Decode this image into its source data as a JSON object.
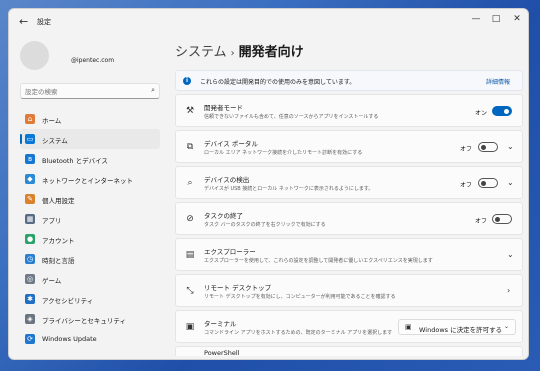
{
  "window": {
    "title": "設定",
    "back_icon": "←",
    "min": "—",
    "max": "□",
    "close": "✕"
  },
  "account": {
    "email": "@ipentec.com"
  },
  "search": {
    "placeholder": "設定の検索"
  },
  "nav": [
    {
      "label": "ホーム",
      "icon": "home-icon",
      "glyph": "⌂",
      "color": "#e07b39"
    },
    {
      "label": "システム",
      "icon": "system-icon",
      "glyph": "▭",
      "color": "#0a78d6",
      "active": true
    },
    {
      "label": "Bluetooth とデバイス",
      "icon": "bluetooth-icon",
      "glyph": "ʙ",
      "color": "#1677d2"
    },
    {
      "label": "ネットワークとインターネット",
      "icon": "network-icon",
      "glyph": "◆",
      "color": "#2a8ad6"
    },
    {
      "label": "個人用設定",
      "icon": "brush-icon",
      "glyph": "✎",
      "color": "#d9822b"
    },
    {
      "label": "アプリ",
      "icon": "apps-icon",
      "glyph": "▦",
      "color": "#5a6b85"
    },
    {
      "label": "アカウント",
      "icon": "account-icon",
      "glyph": "●",
      "color": "#2aa36a"
    },
    {
      "label": "時刻と言語",
      "icon": "time-language-icon",
      "glyph": "◷",
      "color": "#2b7fd0"
    },
    {
      "label": "ゲーム",
      "icon": "gaming-icon",
      "glyph": "◎",
      "color": "#6f7a86"
    },
    {
      "label": "アクセシビリティ",
      "icon": "accessibility-icon",
      "glyph": "✱",
      "color": "#1f6fc4"
    },
    {
      "label": "プライバシーとセキュリティ",
      "icon": "shield-icon",
      "glyph": "◈",
      "color": "#6b7480"
    },
    {
      "label": "Windows Update",
      "icon": "update-icon",
      "glyph": "⟳",
      "color": "#1f77d0"
    }
  ],
  "breadcrumb": {
    "parent": "システム",
    "separator": "›",
    "current": "開発者向け"
  },
  "info": {
    "text": "これらの設定は開発目的での使用のみを意図しています。",
    "link": "詳細情報"
  },
  "rows": [
    {
      "title": "開発者モード",
      "desc": "信頼できないファイルも含めて、任意のソースからアプリをインストールする",
      "icon": "developer-tools-icon",
      "glyph": "⚒",
      "state": "オン",
      "toggle": "on",
      "chevron": false
    },
    {
      "title": "デバイス ポータル",
      "desc": "ローカル エリア ネットワーク接続を介したリモート診断を有効にする",
      "icon": "device-portal-icon",
      "glyph": "⧉",
      "state": "オフ",
      "toggle": "off",
      "chevron": true
    },
    {
      "title": "デバイスの検出",
      "desc": "デバイスが USB 接続とローカル ネットワークに表示されるようにします。",
      "icon": "device-discovery-icon",
      "glyph": "⌕",
      "state": "オフ",
      "toggle": "off",
      "chevron": true
    },
    {
      "title": "タスクの終了",
      "desc": "タスク バーのタスクの終了を右クリックで有効にする",
      "icon": "end-task-icon",
      "glyph": "⊘",
      "state": "オフ",
      "toggle": "off",
      "chevron": false
    },
    {
      "title": "エクスプローラー",
      "desc": "エクスプローラーを使用して、これらの設定を調整して開発者に優しいエクスペリエンスを実現します",
      "icon": "folder-icon",
      "glyph": "▤",
      "chevron": true,
      "chevron_dir": "down"
    },
    {
      "title": "リモート デスクトップ",
      "desc": "リモート デスクトップを有効にし、コンピューターが利用可能であることを確認する",
      "icon": "remote-desktop-icon",
      "glyph": "⤡",
      "chevron": true,
      "chevron_dir": "right"
    },
    {
      "title": "ターミナル",
      "desc": "コマンドライン アプリをホストするための、既定のターミナル アプリを選択します",
      "icon": "terminal-icon",
      "glyph": "▣",
      "dropdown": {
        "label": "Windows に決定を許可する",
        "icon": "terminal-app-icon",
        "glyph": "▣",
        "chevron": "⌄"
      }
    }
  ],
  "partial": {
    "title": "PowerShell"
  }
}
